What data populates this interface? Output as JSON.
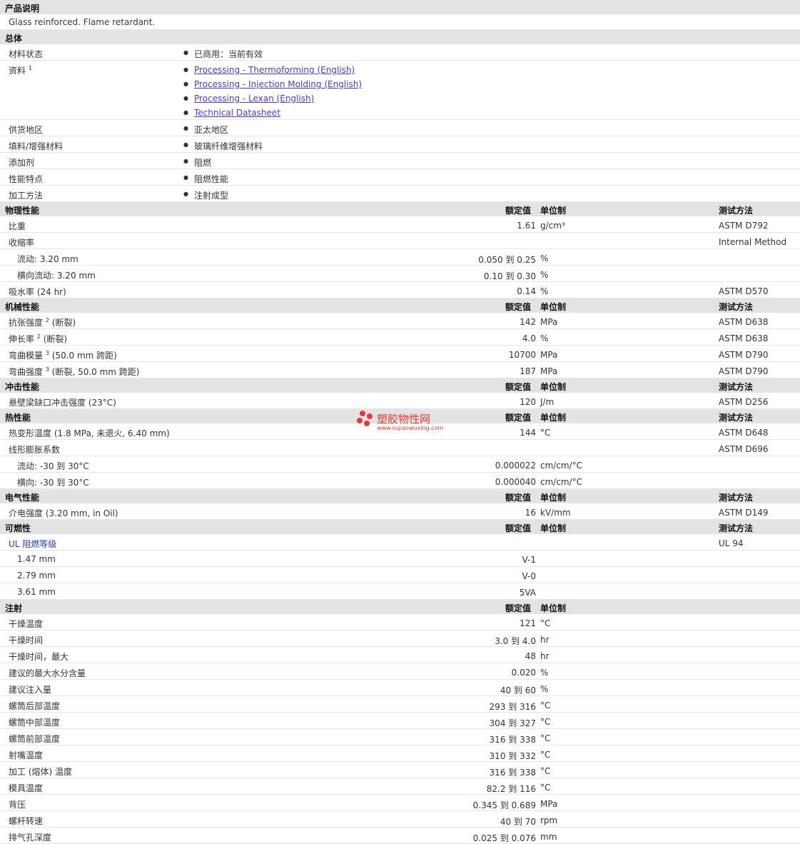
{
  "desc": {
    "title": "产品说明",
    "text": "Glass reinforced. Flame retardant."
  },
  "general": {
    "title": "总体",
    "status_label": "材料状态",
    "status_value": "已商用：当前有效",
    "docs_label": "资料",
    "docs_sup": "1",
    "docs": [
      "Processing - Thermoforming (English)",
      "Processing - Injection Molding (English)",
      "Processing - Lexan (English)",
      "Technical Datasheet"
    ],
    "region_label": "供货地区",
    "region_value": "亚太地区",
    "filler_label": "填料/增强材料",
    "filler_value": "玻璃纤维增强材料",
    "additive_label": "添加剂",
    "additive_value": "阻燃",
    "feature_label": "性能特点",
    "feature_value": "阻燃性能",
    "process_label": "加工方法",
    "process_value": "注射成型"
  },
  "headers": {
    "nominal": "额定值",
    "unit": "单位制",
    "method": "测试方法"
  },
  "physical": {
    "title": "物理性能",
    "rows": [
      {
        "label": "比重",
        "value": "1.61",
        "unit": "g/cm³",
        "method": "ASTM D792"
      },
      {
        "label": "收缩率",
        "value": "",
        "unit": "",
        "method": "Internal Method"
      },
      {
        "label": "流动: 3.20 mm",
        "value": "0.050 到  0.25",
        "unit": "%",
        "method": "",
        "indent": true
      },
      {
        "label": "横向流动: 3.20 mm",
        "value": "0.10 到  0.30",
        "unit": "%",
        "method": "",
        "indent": true
      },
      {
        "label": "吸水率 (24 hr)",
        "value": "0.14",
        "unit": "%",
        "method": "ASTM D570"
      }
    ]
  },
  "mechanical": {
    "title": "机械性能",
    "rows": [
      {
        "label": "抗张强度",
        "sup": "2",
        "suffix": " (断裂)",
        "value": "142",
        "unit": "MPa",
        "method": "ASTM D638"
      },
      {
        "label": "伸长率",
        "sup": "2",
        "suffix": " (断裂)",
        "value": "4.0",
        "unit": "%",
        "method": "ASTM D638"
      },
      {
        "label": "弯曲模量",
        "sup": "3",
        "suffix": " (50.0 mm 跨距)",
        "value": "10700",
        "unit": "MPa",
        "method": "ASTM D790"
      },
      {
        "label": "弯曲强度",
        "sup": "3",
        "suffix": " (断裂, 50.0 mm 跨距)",
        "value": "187",
        "unit": "MPa",
        "method": "ASTM D790"
      }
    ]
  },
  "impact": {
    "title": "冲击性能",
    "rows": [
      {
        "label": "悬壁梁缺口冲击强度 (23°C)",
        "value": "120",
        "unit": "J/m",
        "method": "ASTM D256"
      }
    ]
  },
  "thermal": {
    "title": "热性能",
    "rows": [
      {
        "label": "热变形温度 (1.8 MPa, 未退火, 6.40 mm)",
        "value": "144",
        "unit": "°C",
        "method": "ASTM D648"
      },
      {
        "label": "线形膨胀系数",
        "value": "",
        "unit": "",
        "method": "ASTM D696"
      },
      {
        "label": "流动: -30 到  30°C",
        "value": "0.000022",
        "unit": "cm/cm/°C",
        "method": "",
        "indent": true
      },
      {
        "label": "横向: -30 到  30°C",
        "value": "0.000040",
        "unit": "cm/cm/°C",
        "method": "",
        "indent": true
      }
    ]
  },
  "electrical": {
    "title": "电气性能",
    "rows": [
      {
        "label": "介电强度 (3.20 mm, in Oil)",
        "value": "16",
        "unit": "kV/mm",
        "method": "ASTM D149"
      }
    ]
  },
  "flammability": {
    "title": "可燃性",
    "rows": [
      {
        "label": "UL 阻燃等级",
        "value": "",
        "unit": "",
        "method": "UL 94",
        "blue": true
      },
      {
        "label": "1.47 mm",
        "value": "V-1",
        "unit": "",
        "method": "",
        "indent": true
      },
      {
        "label": "2.79 mm",
        "value": "V-0",
        "unit": "",
        "method": "",
        "indent": true
      },
      {
        "label": "3.61 mm",
        "value": "5VA",
        "unit": "",
        "method": "",
        "indent": true
      }
    ]
  },
  "injection": {
    "title": "注射",
    "rows": [
      {
        "label": "干燥温度",
        "value": "121",
        "unit": "°C"
      },
      {
        "label": "干燥时间",
        "value": "3.0 到  4.0",
        "unit": "hr"
      },
      {
        "label": "干燥时间，最大",
        "value": "48",
        "unit": "hr"
      },
      {
        "label": "建议的最大水分含量",
        "value": "0.020",
        "unit": "%"
      },
      {
        "label": "建议注入量",
        "value": "40 到  60",
        "unit": "%"
      },
      {
        "label": "螺筒后部温度",
        "value": "293 到  316",
        "unit": "°C"
      },
      {
        "label": "螺筒中部温度",
        "value": "304 到  327",
        "unit": "°C"
      },
      {
        "label": "螺筒前部温度",
        "value": "316 到  338",
        "unit": "°C"
      },
      {
        "label": "射嘴温度",
        "value": "310 到  332",
        "unit": "°C"
      },
      {
        "label": "加工 (熔体) 温度",
        "value": "316 到  338",
        "unit": "°C"
      },
      {
        "label": "模具温度",
        "value": "82.2 到  116",
        "unit": "°C"
      },
      {
        "label": "背压",
        "value": "0.345 到  0.689",
        "unit": "MPa"
      },
      {
        "label": "螺杆转速",
        "value": "40 到  70",
        "unit": "rpm"
      },
      {
        "label": "排气孔深度",
        "value": "0.025 到  0.076",
        "unit": "mm"
      }
    ]
  },
  "watermark": {
    "cn": "塑胶物性网",
    "en": "www.sujiaowuxing.com",
    "color": "#e23a3a"
  }
}
